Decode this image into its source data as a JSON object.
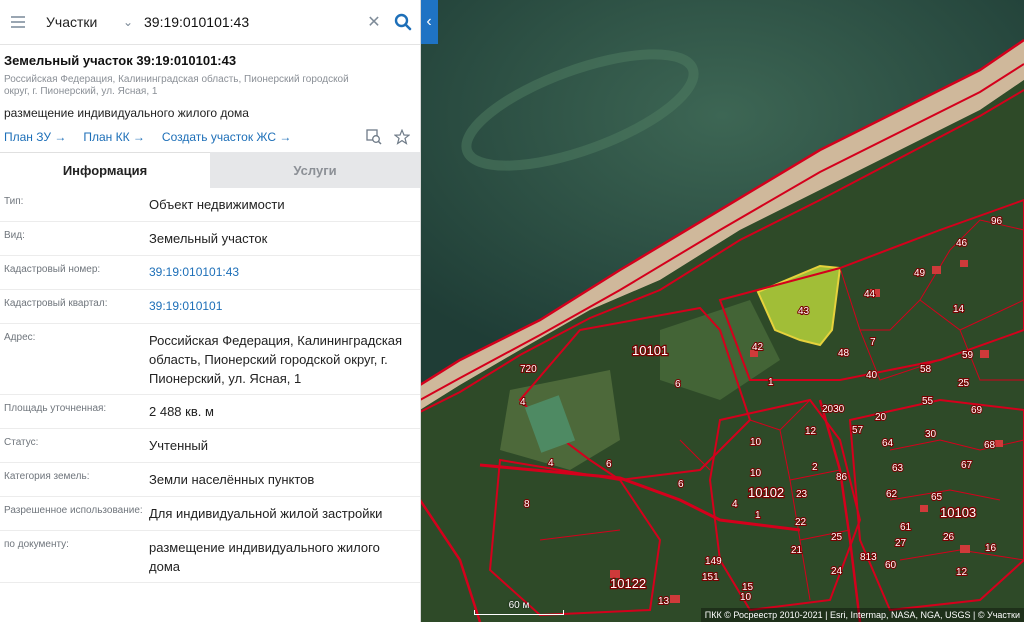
{
  "search": {
    "type_label": "Участки",
    "query": "39:19:010101:43"
  },
  "parcel": {
    "title": "Земельный участок 39:19:010101:43",
    "address": "Российская Федерация, Калининградская область, Пионерский городской округ, г. Пионерский, ул. Ясная, 1",
    "usage": "размещение индивидуального жилого дома",
    "links": [
      "План ЗУ →",
      "План КК →",
      "Создать участок ЖС →"
    ]
  },
  "tabs": [
    "Информация",
    "Услуги"
  ],
  "rows": [
    {
      "label": "Тип:",
      "value": "Объект недвижимости",
      "link": false
    },
    {
      "label": "Вид:",
      "value": "Земельный участок",
      "link": false
    },
    {
      "label": "Кадастровый номер:",
      "value": "39:19:010101:43",
      "link": true
    },
    {
      "label": "Кадастровый квартал:",
      "value": "39:19:010101",
      "link": true
    },
    {
      "label": "Адрес:",
      "value": "Российская Федерация, Калининградская область, Пионерский городской округ, г. Пионерский, ул. Ясная, 1",
      "link": false
    },
    {
      "label": "Площадь уточненная:",
      "value": "2 488 кв. м",
      "link": false
    },
    {
      "label": "Статус:",
      "value": "Учтенный",
      "link": false
    },
    {
      "label": "Категория земель:",
      "value": "Земли населённых пунктов",
      "link": false
    },
    {
      "label": "Разрешенное использование:",
      "value": "Для индивидуальной жилой застройки",
      "link": false
    },
    {
      "label": "по документу:",
      "value": "размещение индивидуального жилого дома",
      "link": false
    }
  ],
  "map": {
    "block_labels": [
      "10101",
      "10102",
      "10103",
      "10122"
    ],
    "parcel_labels": [
      "43",
      "42",
      "1",
      "6",
      "4",
      "4",
      "6",
      "6",
      "8",
      "10",
      "720",
      "96",
      "46",
      "49",
      "44",
      "14",
      "48",
      "7",
      "59",
      "58",
      "25",
      "69",
      "55",
      "30",
      "64",
      "63",
      "62",
      "65",
      "61",
      "68",
      "67",
      "12",
      "2",
      "23",
      "22",
      "21",
      "25",
      "24",
      "149",
      "151",
      "15",
      "13",
      "12",
      "16",
      "26",
      "27",
      "57",
      "10",
      "10",
      "4",
      "1",
      "2030",
      "86",
      "813",
      "60",
      "40",
      "20"
    ],
    "scale": "60 м",
    "attribution": "ПКК © Росреестр 2010-2021 | Esri, Intermap, NASA, NGA, USGS | © Участки",
    "colors": {
      "boundary": "#d4001c",
      "selected": "#c8e63c",
      "water": "#24473d",
      "forest": "#2f4a2c"
    }
  }
}
